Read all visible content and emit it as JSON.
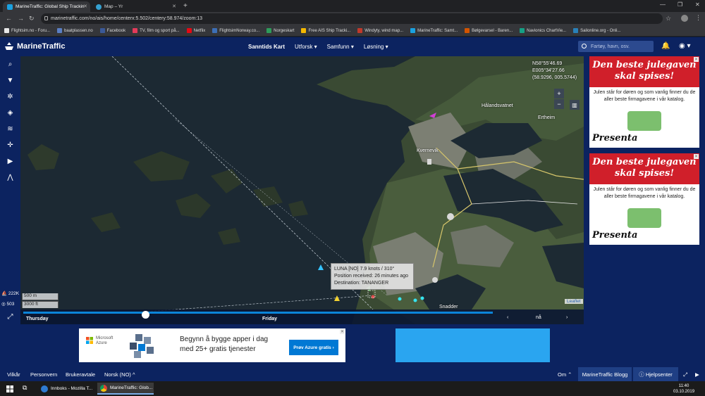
{
  "browser": {
    "tabs": [
      {
        "title": "MarineTraffic: Global Ship Trackin"
      },
      {
        "title": "Map – Yr"
      }
    ],
    "url": "marinetraffic.com/no/ais/home/centerx:5.502/centery:58.974/zoom:13",
    "bookmarks": [
      {
        "label": "Flightsim.no - Foru...",
        "color": "#e8e8e8"
      },
      {
        "label": "baatplassen.no",
        "color": "#5a7fc4"
      },
      {
        "label": "Facebook",
        "color": "#3b5998"
      },
      {
        "label": "TV, film og sport på...",
        "color": "#e33b5a"
      },
      {
        "label": "Netflix",
        "color": "#e50914"
      },
      {
        "label": "FlightsimNorway.co...",
        "color": "#3d6fb6"
      },
      {
        "label": "Norgeskart",
        "color": "#2e9c5a"
      },
      {
        "label": "Free AIS Ship Tracki...",
        "color": "#f5b800"
      },
      {
        "label": "Windyty, wind map...",
        "color": "#c0392b"
      },
      {
        "label": "MarineTraffic: Samt...",
        "color": "#1aa1e0"
      },
      {
        "label": "Bølgevarsel - Baren...",
        "color": "#d35400"
      },
      {
        "label": "Navionics ChartVie...",
        "color": "#16a085"
      },
      {
        "label": "Sailonline.org - Onli...",
        "color": "#2980b9"
      }
    ]
  },
  "header": {
    "logo_text": "MarineTraffic",
    "nav": [
      "Sanntids Kart",
      "Utforsk",
      "Samfunn",
      "Løsning"
    ],
    "search_placeholder": "Fartøy, havn, osv."
  },
  "left_stats": {
    "vessels": "222K",
    "extra": "503"
  },
  "map": {
    "coords": [
      "N58°55'46.69",
      "E005°34'27.66",
      "(58.9296, 005.5744)"
    ],
    "places": [
      "Kvernevik",
      "Hålandsvatnet",
      "Ertheim",
      "Snadder"
    ],
    "tooltip": [
      "LUNA [NO] 7.9 knots / 310°",
      "Position received: 26 minutes ago",
      "Destination: TANANGER"
    ],
    "scale": [
      "500 m",
      "3000 ft"
    ],
    "attribution": "Leaflet"
  },
  "timeline": {
    "days": [
      "Thursday",
      "Friday"
    ],
    "position": 0.26,
    "now_label": "nå"
  },
  "ads": {
    "side": {
      "headline": "Den beste julegaven skal spises!",
      "body": "Julen står for døren og som vanlig finner du de aller beste firmagavene i vår katalog.",
      "brand": "Presenta"
    },
    "bottom": {
      "ms_label": "Microsoft Azure",
      "text_line1": "Begynn å bygge apper i dag",
      "text_line2": "med 25+ gratis tjenester",
      "cta": "Prøv Azure gratis ›"
    }
  },
  "footer": {
    "links": [
      "Vilkår",
      "Personvern",
      "Brukeravtale",
      "Norsk (NO)"
    ],
    "om": "Om",
    "blog": "MarineTraffic Blogg",
    "help": "Hjelpsenter"
  },
  "taskbar": {
    "apps": [
      "Innboks - Mozilla T...",
      "MarineTraffic: Glob..."
    ],
    "time": "11:40",
    "date": "03.10.2019"
  }
}
